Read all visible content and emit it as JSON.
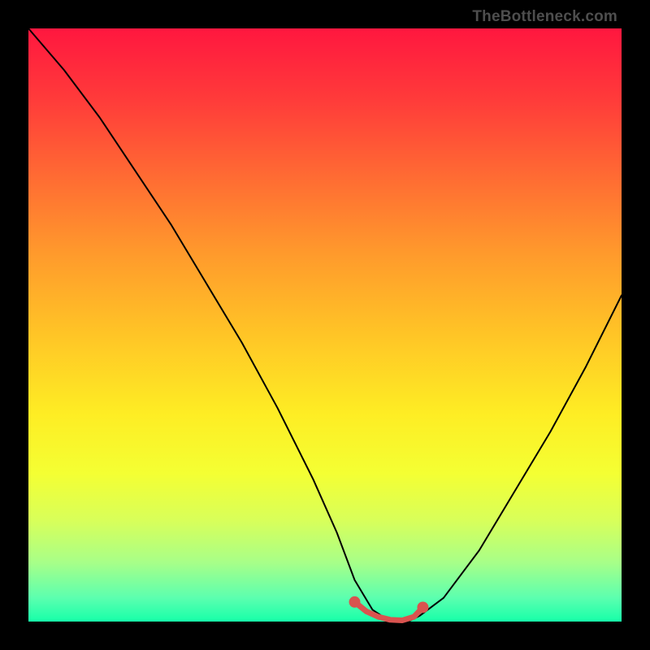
{
  "watermark": "TheBottleneck.com",
  "chart_data": {
    "type": "line",
    "title": "",
    "xlabel": "",
    "ylabel": "",
    "xlim": [
      0,
      100
    ],
    "ylim": [
      0,
      100
    ],
    "grid": false,
    "legend": false,
    "annotations": [],
    "series": [
      {
        "name": "bottleneck-curve",
        "color": "#000000",
        "x": [
          0,
          6,
          12,
          18,
          24,
          30,
          36,
          42,
          48,
          52,
          55,
          58,
          61,
          64,
          66,
          70,
          76,
          82,
          88,
          94,
          100
        ],
        "values": [
          100,
          93,
          85,
          76,
          67,
          57,
          47,
          36,
          24,
          15,
          7,
          2,
          0,
          0,
          1,
          4,
          12,
          22,
          32,
          43,
          55
        ]
      },
      {
        "name": "optimal-range",
        "color": "#d9534f",
        "x": [
          55,
          57,
          59,
          61,
          63,
          65,
          66.5
        ],
        "values": [
          3.3,
          1.7,
          0.8,
          0.3,
          0.2,
          0.8,
          2.4
        ]
      }
    ],
    "markers": [
      {
        "name": "left-endpoint",
        "x": 55,
        "y": 3.3,
        "color": "#d9534f"
      },
      {
        "name": "right-endpoint",
        "x": 66.5,
        "y": 2.4,
        "color": "#d9534f"
      }
    ]
  }
}
